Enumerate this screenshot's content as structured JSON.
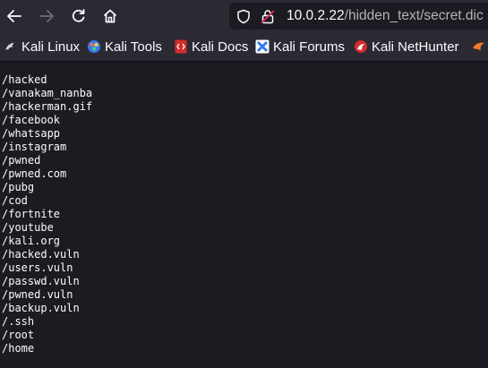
{
  "toolbar": {
    "url_host": "10.0.2.22",
    "url_path": "/hidden_text/secret.dic"
  },
  "bookmarks": [
    {
      "label": "Kali Linux",
      "icon": "kali-dragon-icon"
    },
    {
      "label": "Kali Tools",
      "icon": "kali-tools-icon"
    },
    {
      "label": "Kali Docs",
      "icon": "kali-docs-icon"
    },
    {
      "label": "Kali Forums",
      "icon": "kali-forums-icon"
    },
    {
      "label": "Kali NetHunter",
      "icon": "kali-nethunter-icon"
    }
  ],
  "file_lines": [
    "/hacked",
    "/vanakam_nanba",
    "/hackerman.gif",
    "/facebook",
    "/whatsapp",
    "/instagram",
    "/pwned",
    "/pwned.com",
    "/pubg",
    "/cod",
    "/fortnite",
    "/youtube",
    "/kali.org",
    "/hacked.vuln",
    "/users.vuln",
    "/passwd.vuln",
    "/pwned.vuln",
    "/backup.vuln",
    "/.ssh",
    "/root",
    "/home"
  ],
  "colors": {
    "chrome": "#2b2a33",
    "page_bg": "#1c1b22",
    "text": "#fbfbfe"
  }
}
